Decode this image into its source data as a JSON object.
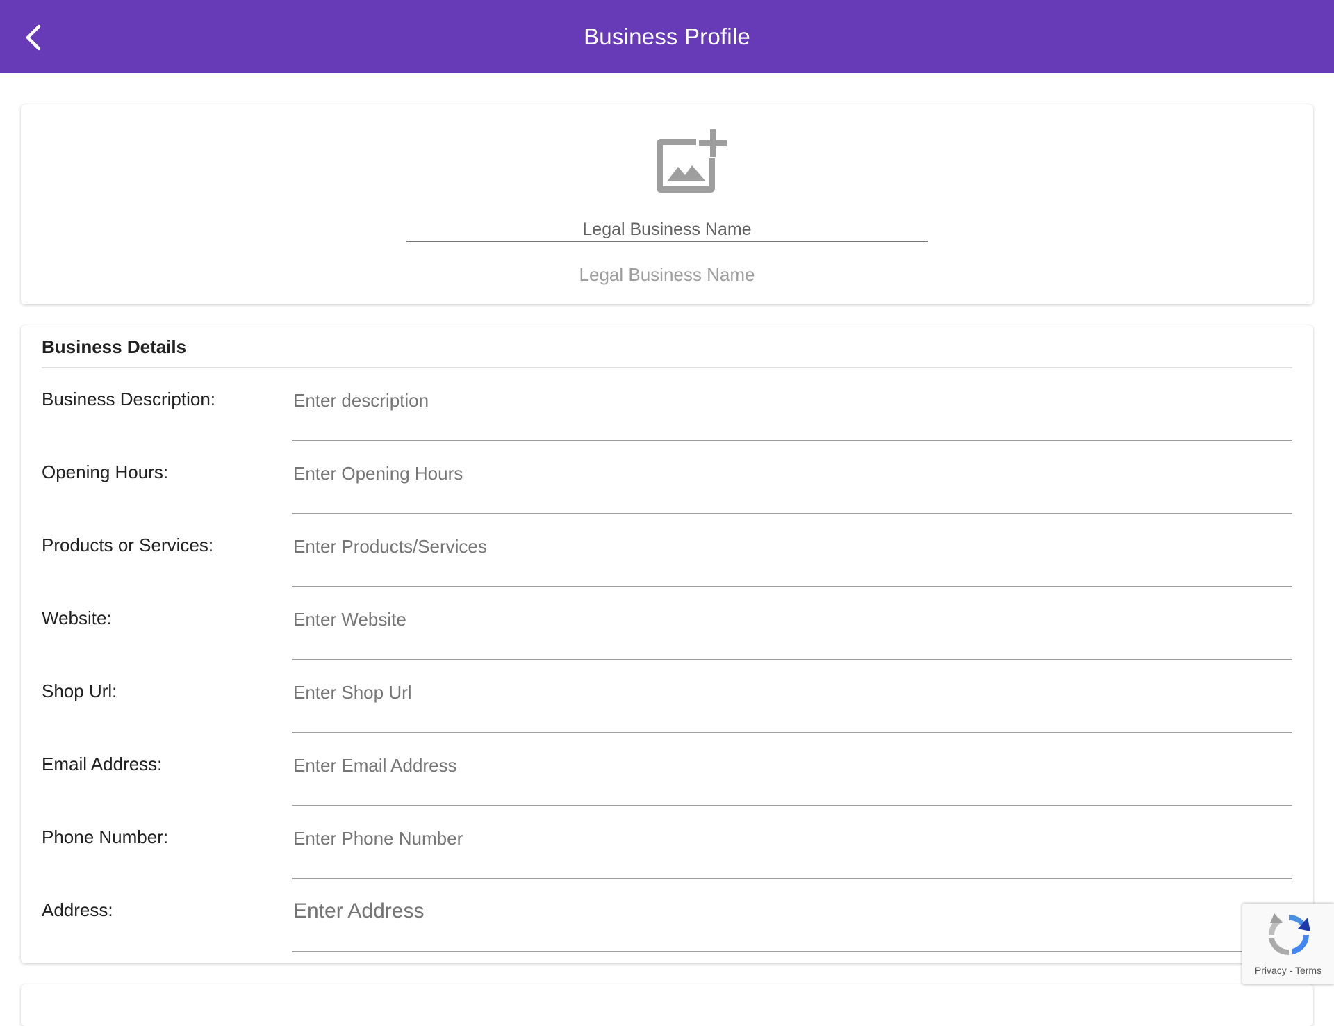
{
  "header": {
    "title": "Business Profile",
    "back_icon": "chevron-left-icon",
    "color": "#673ab7"
  },
  "profile": {
    "image_icon": "add-photo-icon",
    "legal_name_label": "Legal Business Name",
    "legal_name_placeholder": "Legal Business Name",
    "legal_name_value": ""
  },
  "details": {
    "title": "Business Details",
    "fields": [
      {
        "label": "Business Description:",
        "placeholder": "Enter description",
        "value": ""
      },
      {
        "label": "Opening Hours:",
        "placeholder": "Enter Opening Hours",
        "value": ""
      },
      {
        "label": "Products or Services:",
        "placeholder": "Enter Products/Services",
        "value": ""
      },
      {
        "label": "Website:",
        "placeholder": "Enter Website",
        "value": ""
      },
      {
        "label": "Shop Url:",
        "placeholder": "Enter Shop Url",
        "value": ""
      },
      {
        "label": "Email Address:",
        "placeholder": "Enter Email Address",
        "value": ""
      },
      {
        "label": "Phone Number:",
        "placeholder": "Enter Phone Number",
        "value": ""
      },
      {
        "label": "Address:",
        "placeholder": "Enter Address",
        "value": ""
      }
    ]
  },
  "recaptcha": {
    "icon": "recaptcha-icon",
    "privacy": "Privacy",
    "separator": " - ",
    "terms": "Terms"
  }
}
